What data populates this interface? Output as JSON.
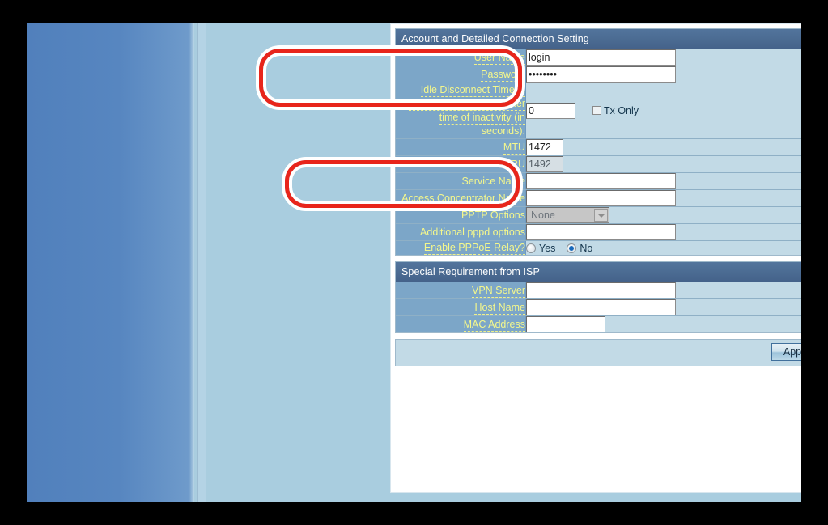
{
  "page": {
    "sections": [
      {
        "id": "account",
        "title": "Account and Detailed Connection Setting",
        "rows": [
          {
            "id": "user-name",
            "label": "User Name",
            "type": "text",
            "value": "login",
            "width": "w185"
          },
          {
            "id": "password",
            "label": "Password",
            "type": "password",
            "value": "••••••••",
            "width": "w185"
          },
          {
            "id": "idle-disconnect",
            "label": "Idle Disconnect Time in seconds: Disconnect after time of inactivity (in seconds).",
            "type": "text-with-checkbox",
            "value": "0",
            "width": "w60",
            "checkbox_label": "Tx Only",
            "checkbox_checked": false
          },
          {
            "id": "mtu",
            "label": "MTU",
            "type": "text",
            "value": "1472",
            "width": "w45"
          },
          {
            "id": "mru",
            "label": "MRU",
            "type": "text",
            "value": "1492",
            "width": "w45",
            "disabled": true
          },
          {
            "id": "service-name",
            "label": "Service Name",
            "type": "text",
            "value": "",
            "width": "w185"
          },
          {
            "id": "access-concentrator-name",
            "label": "Access Concentrator Name",
            "type": "text",
            "value": "",
            "width": "w185"
          },
          {
            "id": "pptp-options",
            "label": "PPTP Options",
            "type": "select",
            "value": "None",
            "options": [
              "None"
            ],
            "disabled": true
          },
          {
            "id": "additional-pppd-options",
            "label": "Additional pppd options",
            "type": "text",
            "value": "",
            "width": "w185"
          },
          {
            "id": "enable-pppoe-relay",
            "label": "Enable PPPoE Relay?",
            "type": "radio",
            "options": [
              "Yes",
              "No"
            ],
            "selected": "No"
          }
        ]
      },
      {
        "id": "special-isp",
        "title": "Special Requirement from ISP",
        "rows": [
          {
            "id": "vpn-server",
            "label": "VPN Server",
            "type": "text",
            "value": "",
            "width": "w185"
          },
          {
            "id": "host-name",
            "label": "Host Name",
            "type": "text",
            "value": "",
            "width": "w185"
          },
          {
            "id": "mac-address",
            "label": "MAC Address",
            "type": "text",
            "value": "",
            "width": "w100"
          }
        ]
      }
    ],
    "apply_button": "Apply"
  },
  "annotations": [
    {
      "id": "credentials",
      "target": "User Name and Password fields",
      "color": "#e8251b"
    },
    {
      "id": "mtu",
      "target": "MTU field",
      "color": "#e8251b"
    }
  ],
  "colors": {
    "section_header": "#4b6b92",
    "label_cell": "#7ca6c8",
    "value_cell": "#c2dae6",
    "label_text": "#f4f78c",
    "left_panel": "#5684be",
    "page_background": "#a9cddf",
    "annotation": "#e8251b"
  }
}
